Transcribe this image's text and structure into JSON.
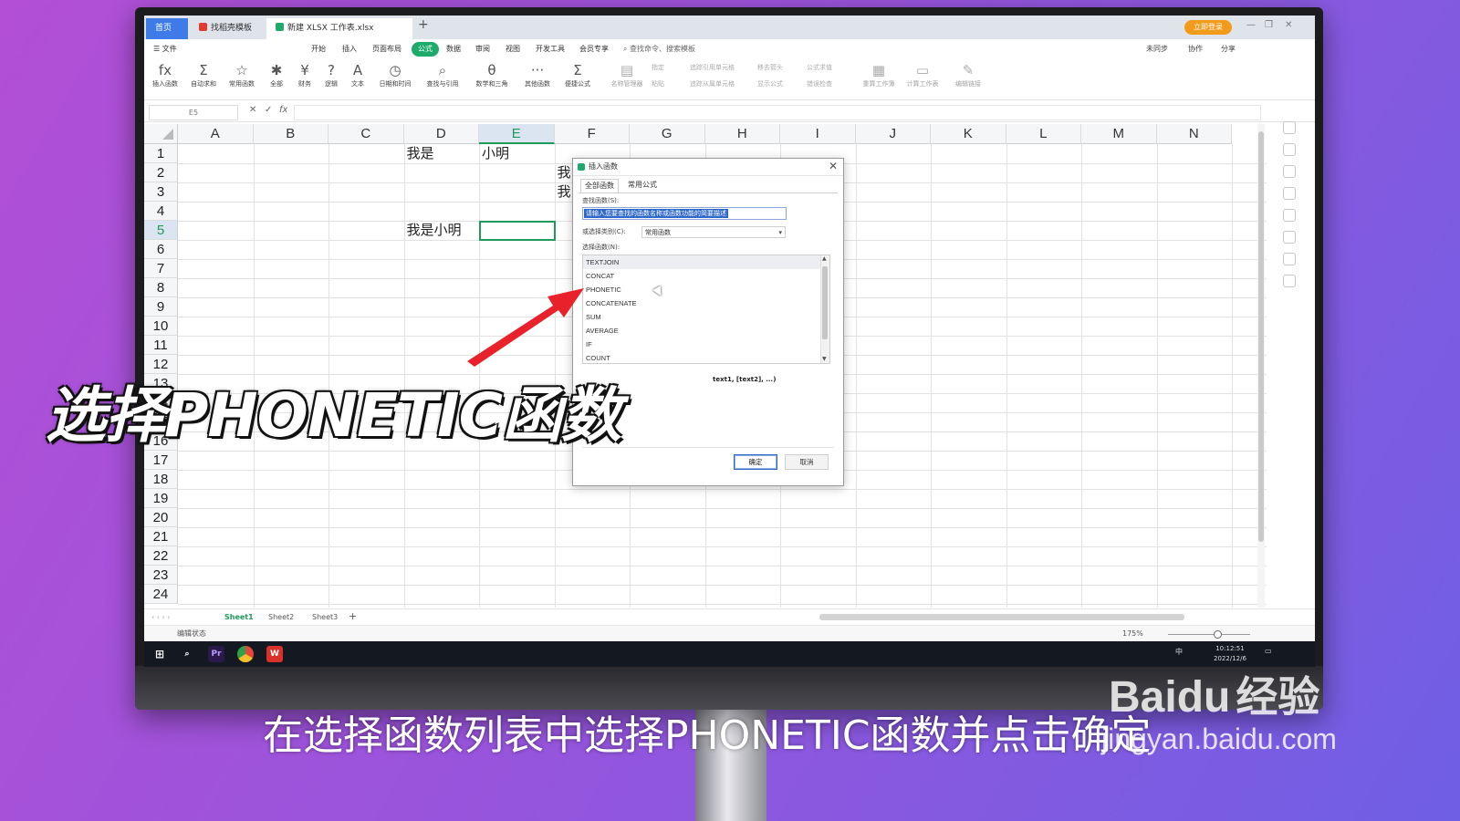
{
  "tabs": {
    "home": "首页",
    "template": "找稻壳模板",
    "workbook": "新建 XLSX 工作表.xlsx",
    "login": "立即登录"
  },
  "menus": [
    "文件",
    "开始",
    "插入",
    "页面布局",
    "公式",
    "数据",
    "审阅",
    "视图",
    "开发工具",
    "会员专享"
  ],
  "active_menu": "公式",
  "search_cmd": "查找命令、搜索模板",
  "right_menus": [
    "未同步",
    "协作",
    "分享"
  ],
  "ribbon": [
    {
      "icon": "fx",
      "label": "插入函数"
    },
    {
      "icon": "Σ",
      "label": "自动求和"
    },
    {
      "icon": "☆",
      "label": "常用函数"
    },
    {
      "icon": "✱",
      "label": "全部"
    },
    {
      "icon": "¥",
      "label": "财务"
    },
    {
      "icon": "?",
      "label": "逻辑"
    },
    {
      "icon": "A",
      "label": "文本"
    },
    {
      "icon": "◷",
      "label": "日期和时间"
    },
    {
      "icon": "⌕",
      "label": "查找与引用"
    },
    {
      "icon": "θ",
      "label": "数学和三角"
    },
    {
      "icon": "···",
      "label": "其他函数"
    },
    {
      "icon": "Σ",
      "label": "便捷公式"
    },
    {
      "icon": "▤",
      "label": "名称管理器"
    },
    {
      "icon": "▦",
      "label": "重算工作簿"
    },
    {
      "icon": "▭",
      "label": "计算工作表"
    },
    {
      "icon": "✎",
      "label": "编辑链接"
    }
  ],
  "ribbon_small": [
    "指定",
    "粘贴",
    "追踪引用单元格",
    "追踪从属单元格",
    "移去箭头",
    "显示公式",
    "公式求值",
    "错误检查"
  ],
  "formula_bar": {
    "namebox": "E5",
    "fx": "fx"
  },
  "columns": [
    "A",
    "B",
    "C",
    "D",
    "E",
    "F",
    "G",
    "H",
    "I",
    "J",
    "K",
    "L",
    "M",
    "N"
  ],
  "rows": [
    "1",
    "2",
    "3",
    "4",
    "5",
    "6",
    "7",
    "8",
    "9",
    "10",
    "11",
    "12",
    "13",
    "14",
    "15",
    "16",
    "17",
    "18",
    "19",
    "20",
    "21",
    "22",
    "23",
    "24"
  ],
  "selected_cell": "E5",
  "cells": {
    "D1": "我是",
    "E1": "小明",
    "F2": "我",
    "F3": "我",
    "D5": "我是小明"
  },
  "sheets": [
    "Sheet1",
    "Sheet2",
    "Sheet3"
  ],
  "active_sheet": "Sheet1",
  "status": {
    "mode": "编辑状态",
    "zoom": "175%"
  },
  "taskbar": {
    "ime": "中",
    "time": "10:12:51",
    "date": "2022/12/6"
  },
  "dialog": {
    "title": "插入函数",
    "tabs": [
      "全部函数",
      "常用公式"
    ],
    "search_label": "查找函数(S):",
    "search_value": "请输入您要查找的函数名称或函数功能的简要描述",
    "category_label": "或选择类别(C):",
    "category_value": "常用函数",
    "list_label": "选择函数(N):",
    "functions": [
      "TEXTJOIN",
      "CONCAT",
      "PHONETIC",
      "CONCATENATE",
      "SUM",
      "AVERAGE",
      "IF",
      "COUNT"
    ],
    "selected_function": "TEXTJOIN",
    "syntax": "text1, [text2], ...)",
    "ok": "确定",
    "cancel": "取消"
  },
  "overlay_title": "选择PHONETIC函数",
  "subtitle": "在选择函数列表中选择PHONETIC函数并点击确定",
  "watermark": {
    "brand": "Baidu",
    "jingyan": "经验",
    "url": "jingyan.baidu.com"
  },
  "colors": {
    "accent_green": "#1eaa6a",
    "select_blue": "#2e68c9",
    "arrow_red": "#e8212b"
  }
}
